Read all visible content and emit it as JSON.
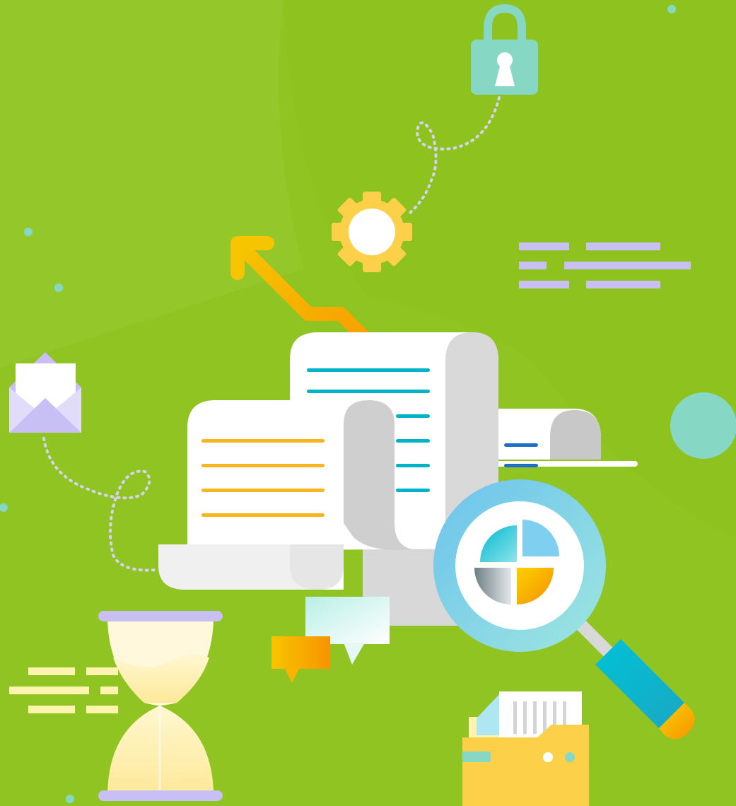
{
  "scene": {
    "description_kind": "flat-illustration",
    "icons": [
      "padlock-icon",
      "gear-icon",
      "trend-arrow-icon",
      "envelope-icon",
      "document-scroll-icon",
      "magnifier-icon",
      "pie-chart-icon",
      "chat-bubble-icon",
      "hourglass-icon",
      "folder-icon",
      "text-lines-icon"
    ]
  },
  "colors": {
    "background": "#8dc21f",
    "paper": "#ffffff",
    "paper_shadow": "#d6d6d6",
    "accent_orange": "#f9b51d",
    "accent_teal": "#00b4c8",
    "accent_blue": "#1f6fc8",
    "lavender": "#c8c0f4",
    "mint": "#86d8c4",
    "yellow": "#fdd04a",
    "cream": "#fff3b0"
  }
}
